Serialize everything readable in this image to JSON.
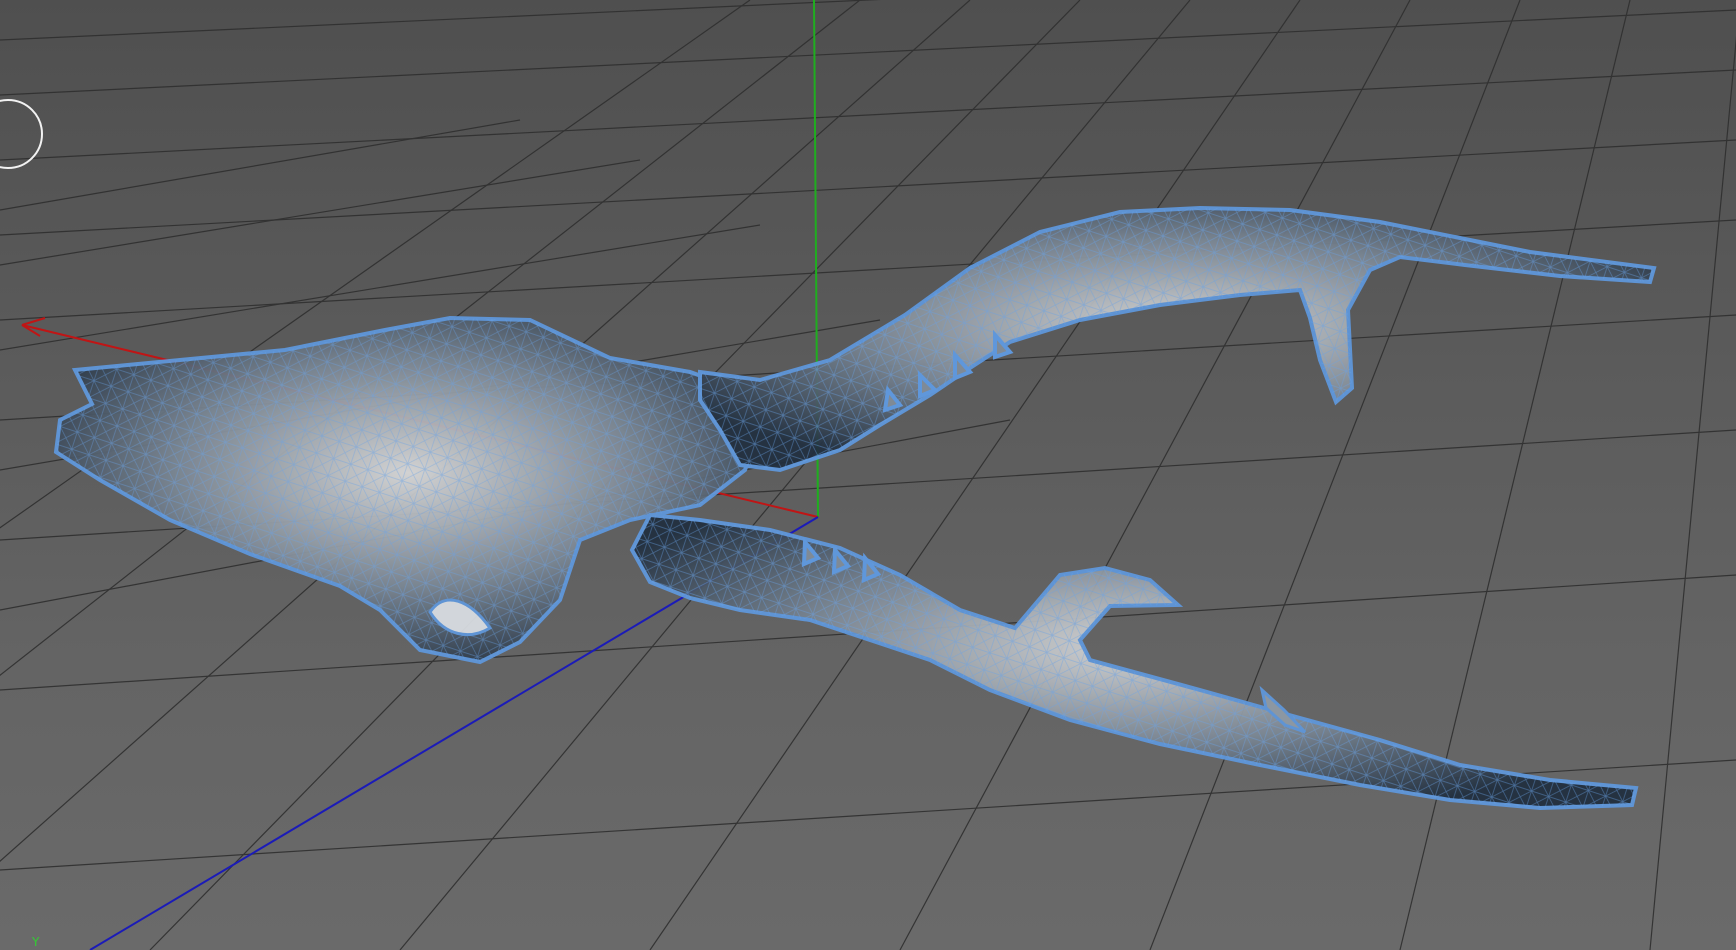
{
  "viewport": {
    "background_color": "#5f5f5f",
    "grid_color": "#2f2f2f",
    "axis_colors": {
      "x": "#c01515",
      "y": "#1fae1f",
      "z": "#1b1bb8"
    },
    "wireframe_color": "#5f97db",
    "axis_gizmo_label": "Y",
    "navigation_ring_icon": "orbit-circle-icon"
  }
}
